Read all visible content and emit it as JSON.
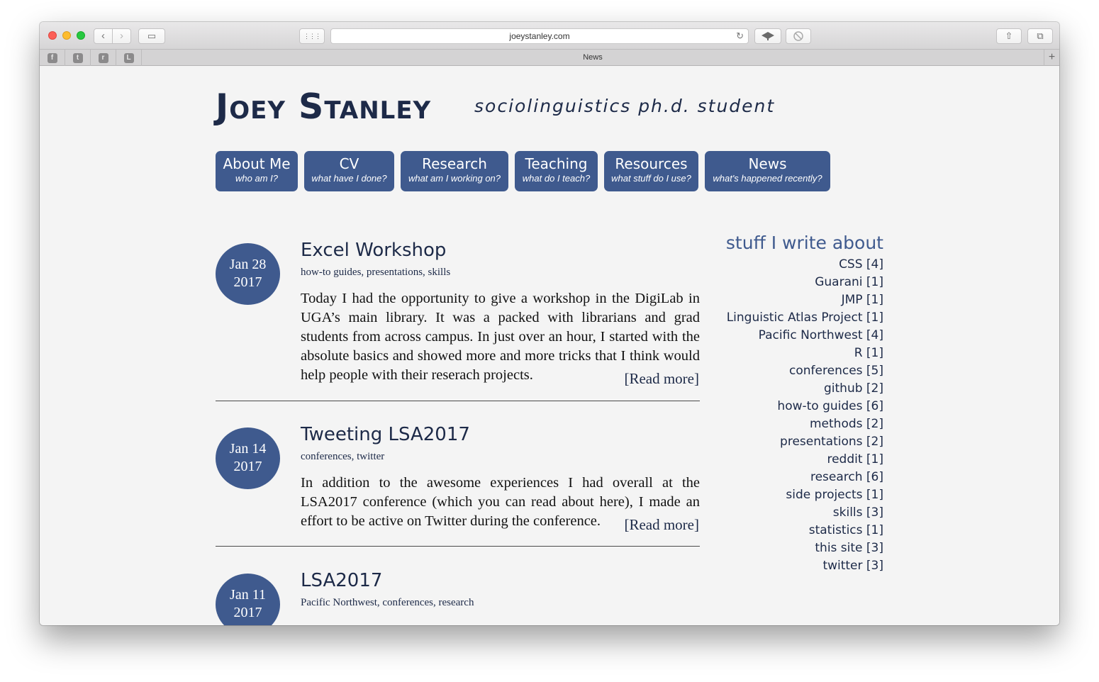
{
  "browser": {
    "url": "joeystanley.com",
    "tab_title": "News",
    "back_icon": "‹",
    "forward_icon": "›",
    "sidebar_icon": "▭",
    "grid_icon": "⋮⋮⋮",
    "reload_icon": "↻",
    "share_icon": "⇧",
    "tabs_icon": "⧉",
    "tab_add": "+",
    "pinned_tabs": [
      "f",
      "t",
      "r",
      "L"
    ]
  },
  "site": {
    "name": "Joey Stanley",
    "tagline": "sociolinguistics ph.d. student"
  },
  "menu": [
    {
      "title": "About Me",
      "subtitle": "who am I?"
    },
    {
      "title": "CV",
      "subtitle": "what have I done?"
    },
    {
      "title": "Research",
      "subtitle": "what am I working on?"
    },
    {
      "title": "Teaching",
      "subtitle": "what do I teach?"
    },
    {
      "title": "Resources",
      "subtitle": "what stuff do I use?"
    },
    {
      "title": "News",
      "subtitle": "what's happened recently?"
    }
  ],
  "posts": [
    {
      "date_line1": "Jan 28",
      "date_line2": "2017",
      "title": "Excel Workshop",
      "tags": "how-to guides, presentations, skills",
      "body": "Today I had the opportunity to give a workshop in the DigiLab in UGA’s main library. It was a packed with librarians and grad students from across campus. In just over an hour, I started with the absolute basics and showed more and more tricks that I think would help people with their reserach projects.",
      "read_more": "[Read more]"
    },
    {
      "date_line1": "Jan 14",
      "date_line2": "2017",
      "title": "Tweeting LSA2017",
      "tags": "conferences, twitter",
      "body": "In addition to the awesome experiences I had overall at the LSA2017 conference (which you can read about here), I made an effort to be active on Twitter during the conference.",
      "read_more": "[Read more]"
    },
    {
      "date_line1": "Jan 11",
      "date_line2": "2017",
      "title": "LSA2017",
      "tags": "Pacific Northwest, conferences, research"
    }
  ],
  "sidebar": {
    "title": "stuff I write about",
    "topics": [
      "CSS [4]",
      "Guarani [1]",
      "JMP [1]",
      "Linguistic Atlas Project [1]",
      "Pacific Northwest [4]",
      "R [1]",
      "conferences [5]",
      "github [2]",
      "how-to guides [6]",
      "methods [2]",
      "presentations [2]",
      "reddit [1]",
      "research [6]",
      "side projects [1]",
      "skills [3]",
      "statistics [1]",
      "this site [3]",
      "twitter [3]"
    ]
  }
}
